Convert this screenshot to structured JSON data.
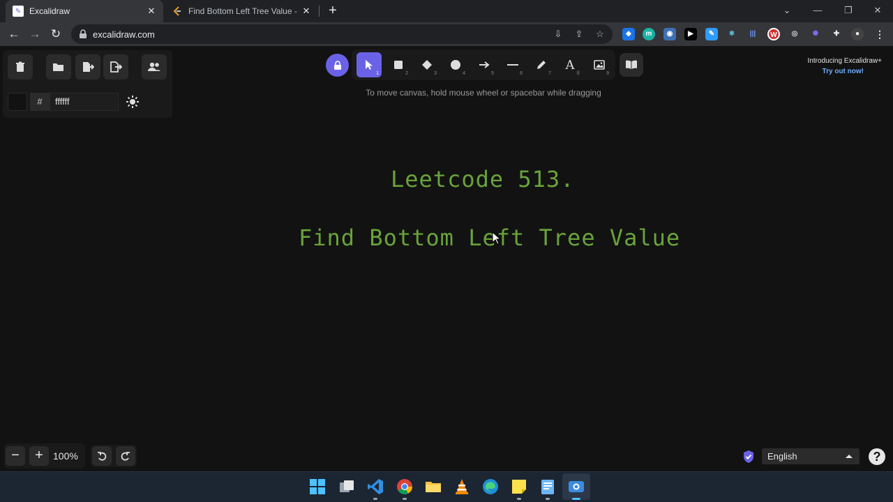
{
  "browser": {
    "tabs": [
      {
        "title": "Excalidraw",
        "active": true
      },
      {
        "title": "Find Bottom Left Tree Value - Lee",
        "active": false
      }
    ],
    "new_tab": "+",
    "url": "excalidraw.com"
  },
  "left_panel": {
    "hex_symbol": "#",
    "hex_value": "ffffff"
  },
  "shape_toolbar": {
    "tools": [
      {
        "name": "selection",
        "key": "1",
        "selected": true
      },
      {
        "name": "rectangle",
        "key": "2"
      },
      {
        "name": "diamond",
        "key": "3"
      },
      {
        "name": "ellipse",
        "key": "4"
      },
      {
        "name": "arrow",
        "key": "5"
      },
      {
        "name": "line",
        "key": "6"
      },
      {
        "name": "draw",
        "key": "7"
      },
      {
        "name": "text",
        "key": "8",
        "glyph": "A"
      },
      {
        "name": "image",
        "key": "9"
      }
    ],
    "hint": "To move canvas, hold mouse wheel or spacebar while dragging"
  },
  "promo": {
    "line1": "Introducing Excalidraw+",
    "line2": "Try out now!"
  },
  "canvas": {
    "text_line_1": "Leetcode 513.",
    "text_line_2": "Find Bottom Left Tree Value",
    "text_color": "#69a33a"
  },
  "footer": {
    "zoom_out": "−",
    "zoom_in": "+",
    "zoom_level": "100%",
    "language": "English",
    "help": "?"
  },
  "colors": {
    "accent": "#6a62e6",
    "canvas_bg": "#121212",
    "link": "#6db0ff"
  }
}
